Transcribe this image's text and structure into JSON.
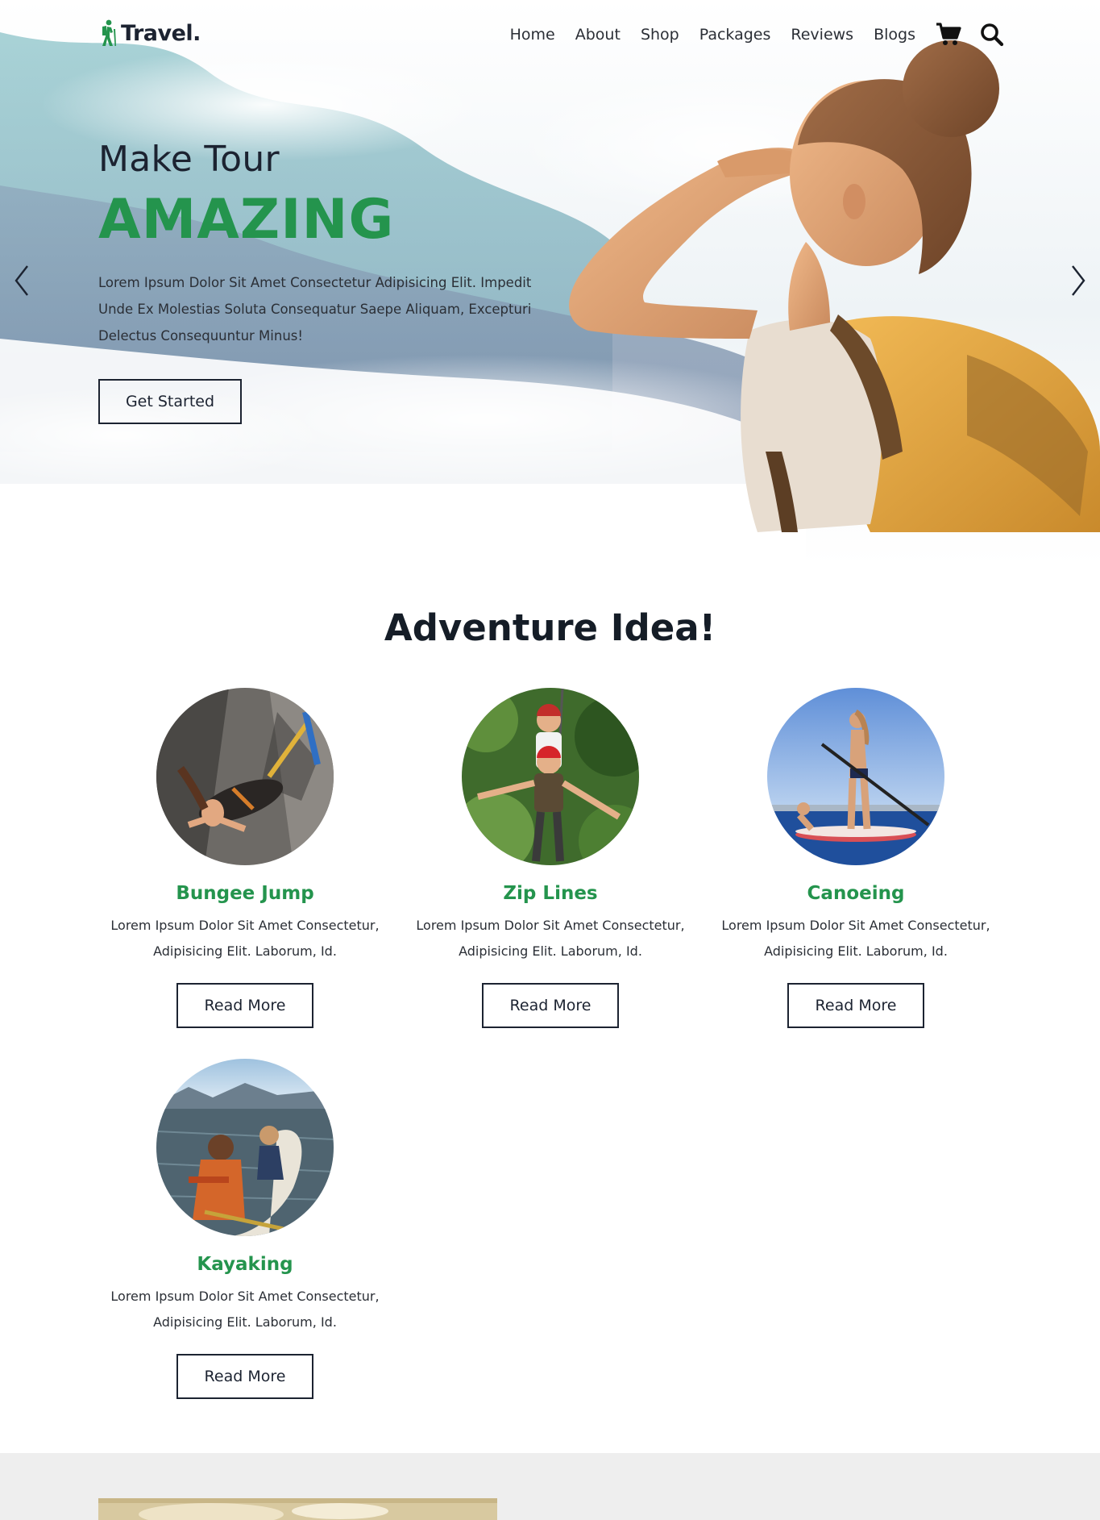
{
  "header": {
    "logo_text": "Travel.",
    "nav": [
      "Home",
      "About",
      "Shop",
      "Packages",
      "Reviews",
      "Blogs"
    ],
    "icons": [
      "cart-icon",
      "search-icon"
    ]
  },
  "hero": {
    "subtitle": "Make Tour",
    "title": "AMAZING",
    "description": "Lorem Ipsum Dolor Sit Amet Consectetur Adipisicing Elit. Impedit Unde Ex Molestias Soluta Consequatur Saepe Aliquam, Excepturi Delectus Consequuntur Minus!",
    "button_label": "Get Started"
  },
  "adventure": {
    "title": "Adventure Idea!",
    "cards": [
      {
        "title": "Bungee Jump",
        "description": "Lorem Ipsum Dolor Sit Amet Consectetur, Adipisicing Elit. Laborum, Id.",
        "button_label": "Read More"
      },
      {
        "title": "Zip Lines",
        "description": "Lorem Ipsum Dolor Sit Amet Consectetur, Adipisicing Elit. Laborum, Id.",
        "button_label": "Read More"
      },
      {
        "title": "Canoeing",
        "description": "Lorem Ipsum Dolor Sit Amet Consectetur, Adipisicing Elit. Laborum, Id.",
        "button_label": "Read More"
      },
      {
        "title": "Kayaking",
        "description": "Lorem Ipsum Dolor Sit Amet Consectetur, Adipisicing Elit. Laborum, Id.",
        "button_label": "Read More"
      }
    ]
  },
  "colors": {
    "accent": "#24944d",
    "text": "#1c2331",
    "band": "#eeeeee"
  }
}
